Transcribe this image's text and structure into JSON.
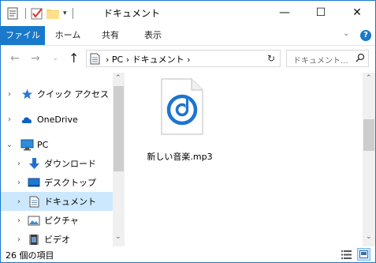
{
  "window": {
    "title": "ドキュメント",
    "accent_color": "#1979ca",
    "controls": {
      "minimize": "—",
      "maximize": "☐",
      "close": "✕"
    }
  },
  "quick_access_toolbar": {
    "items": [
      "properties-icon",
      "checkmark-icon",
      "folder-icon"
    ],
    "dropdown": "▾"
  },
  "ribbon": {
    "tabs": [
      "ファイル",
      "ホーム",
      "共有",
      "表示"
    ],
    "collapse": "⌄",
    "help": "?"
  },
  "navigation": {
    "back": "←",
    "forward": "→",
    "recent": "⌄",
    "up": "↑",
    "address": "› PC › ドキュメント ›",
    "address_dropdown": "⌄",
    "refresh": "↻",
    "search_placeholder": "ドキュメント..."
  },
  "nav_pane": {
    "items": [
      {
        "label": "クイック アクセス",
        "icon": "star-icon",
        "chevron": "›",
        "level": 0
      },
      {
        "label": "OneDrive",
        "icon": "cloud-icon",
        "chevron": "›",
        "level": 0
      },
      {
        "label": "PC",
        "icon": "computer-icon",
        "chevron": "⌄",
        "level": 0
      },
      {
        "label": "ダウンロード",
        "icon": "download-arrow-icon",
        "chevron": "›",
        "level": 1
      },
      {
        "label": "デスクトップ",
        "icon": "desktop-icon",
        "chevron": "›",
        "level": 1
      },
      {
        "label": "ドキュメント",
        "icon": "document-icon",
        "chevron": "›",
        "level": 1,
        "selected": true
      },
      {
        "label": "ピクチャ",
        "icon": "pictures-icon",
        "chevron": "›",
        "level": 1
      },
      {
        "label": "ビデオ",
        "icon": "video-icon",
        "chevron": "›",
        "level": 1
      }
    ],
    "scroll_up": "⌃",
    "scroll_down": "⌄"
  },
  "content": {
    "files": [
      {
        "name": "新しい音楽.mp3",
        "icon": "groove-music-icon"
      }
    ],
    "scroll_up": "⌃",
    "scroll_down": "⌄"
  },
  "status": {
    "item_count": "26 個の項目",
    "selected_view": "large-icons"
  }
}
